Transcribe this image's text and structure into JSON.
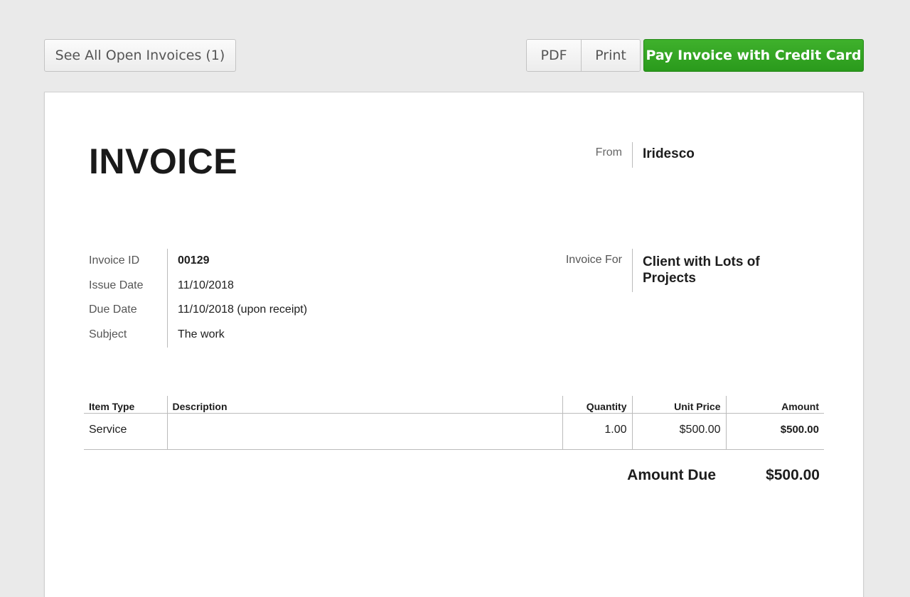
{
  "toolbar": {
    "open_invoices_label": "See All Open Invoices (1)",
    "pdf_label": "PDF",
    "print_label": "Print",
    "pay_label": "Pay Invoice with Credit Card",
    "pay_color": "#2fa321"
  },
  "invoice": {
    "title": "INVOICE",
    "from_label": "From",
    "from_value": "Iridesco",
    "meta": {
      "id_label": "Invoice ID",
      "id_value": "00129",
      "issue_label": "Issue Date",
      "issue_value": "11/10/2018",
      "due_label": "Due Date",
      "due_value": "11/10/2018 (upon receipt)",
      "subject_label": "Subject",
      "subject_value": "The work"
    },
    "for_label": "Invoice For",
    "for_value": "Client with Lots of Projects",
    "table": {
      "headers": [
        "Item Type",
        "Description",
        "Quantity",
        "Unit Price",
        "Amount"
      ],
      "rows": [
        [
          "Service",
          "",
          "1.00",
          "$500.00",
          "$500.00"
        ]
      ]
    },
    "amount_due_label": "Amount Due",
    "amount_due_value": "$500.00"
  }
}
